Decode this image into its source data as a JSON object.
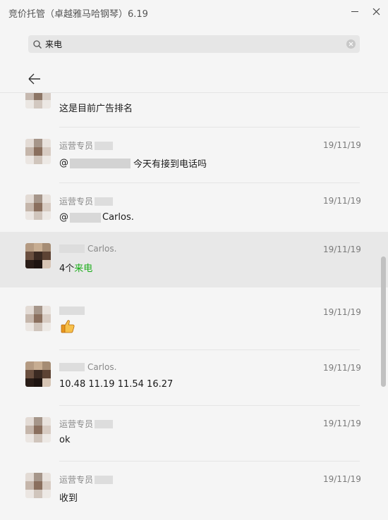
{
  "window": {
    "title": "竞价托管（卓越雅马哈钢琴）6.19"
  },
  "search": {
    "value": "来电"
  },
  "messages": [
    {
      "name": "",
      "time": "",
      "text": "这是目前广告排名",
      "avatar": "a"
    },
    {
      "name": "运营专员",
      "time": "19/11/19",
      "prefix": "@",
      "text": "今天有接到电话吗",
      "avatar": "a"
    },
    {
      "name": "运营专员",
      "time": "19/11/19",
      "prefix": "@",
      "text": "Carlos.",
      "avatar": "a"
    },
    {
      "name": "Carlos.",
      "time": "19/11/19",
      "text": "4个",
      "highlight": "来电",
      "avatar": "b"
    },
    {
      "name": "",
      "time": "19/11/19",
      "icon": "thumbs-up-icon",
      "avatar": "a"
    },
    {
      "name": "Carlos.",
      "time": "19/11/19",
      "text": "10.48 11.19 11.54 16.27",
      "avatar": "b"
    },
    {
      "name": "运营专员",
      "time": "19/11/19",
      "text": "ok",
      "avatar": "a"
    },
    {
      "name": "运营专员",
      "time": "19/11/19",
      "text": "收到",
      "avatar": "a"
    }
  ],
  "colors": {
    "highlight": "#1aad19",
    "selected_bg": "#e8e8e8"
  }
}
